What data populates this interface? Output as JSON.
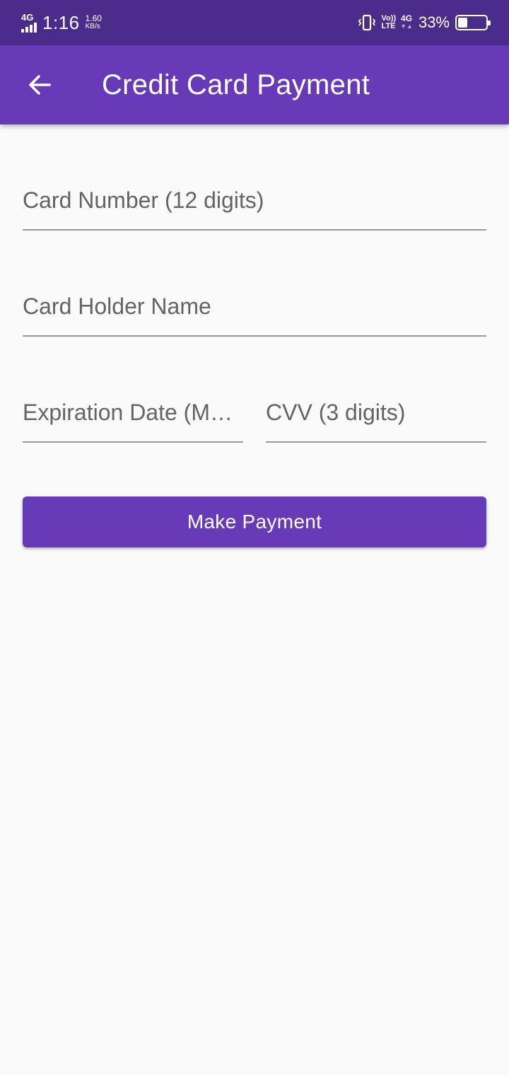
{
  "status_bar": {
    "network_label": "4G",
    "time": "1:16",
    "speed_value": "1.60",
    "speed_unit": "KB/s",
    "volte_top": "Vo))",
    "volte_bottom": "LTE",
    "data_label": "4G",
    "data_arrows": "▼▲",
    "battery_percent": "33%",
    "battery_level": 0.33
  },
  "app_bar": {
    "title": "Credit Card Payment",
    "background": "#673ab7"
  },
  "form": {
    "card_number": {
      "placeholder": "Card Number (12 digits)",
      "value": ""
    },
    "holder_name": {
      "placeholder": "Card Holder Name",
      "value": ""
    },
    "expiration": {
      "placeholder": "Expiration Date (M…",
      "value": ""
    },
    "cvv": {
      "placeholder": "CVV (3 digits)",
      "value": ""
    }
  },
  "pay_button": {
    "label": "Make Payment",
    "color": "#673ab7"
  }
}
